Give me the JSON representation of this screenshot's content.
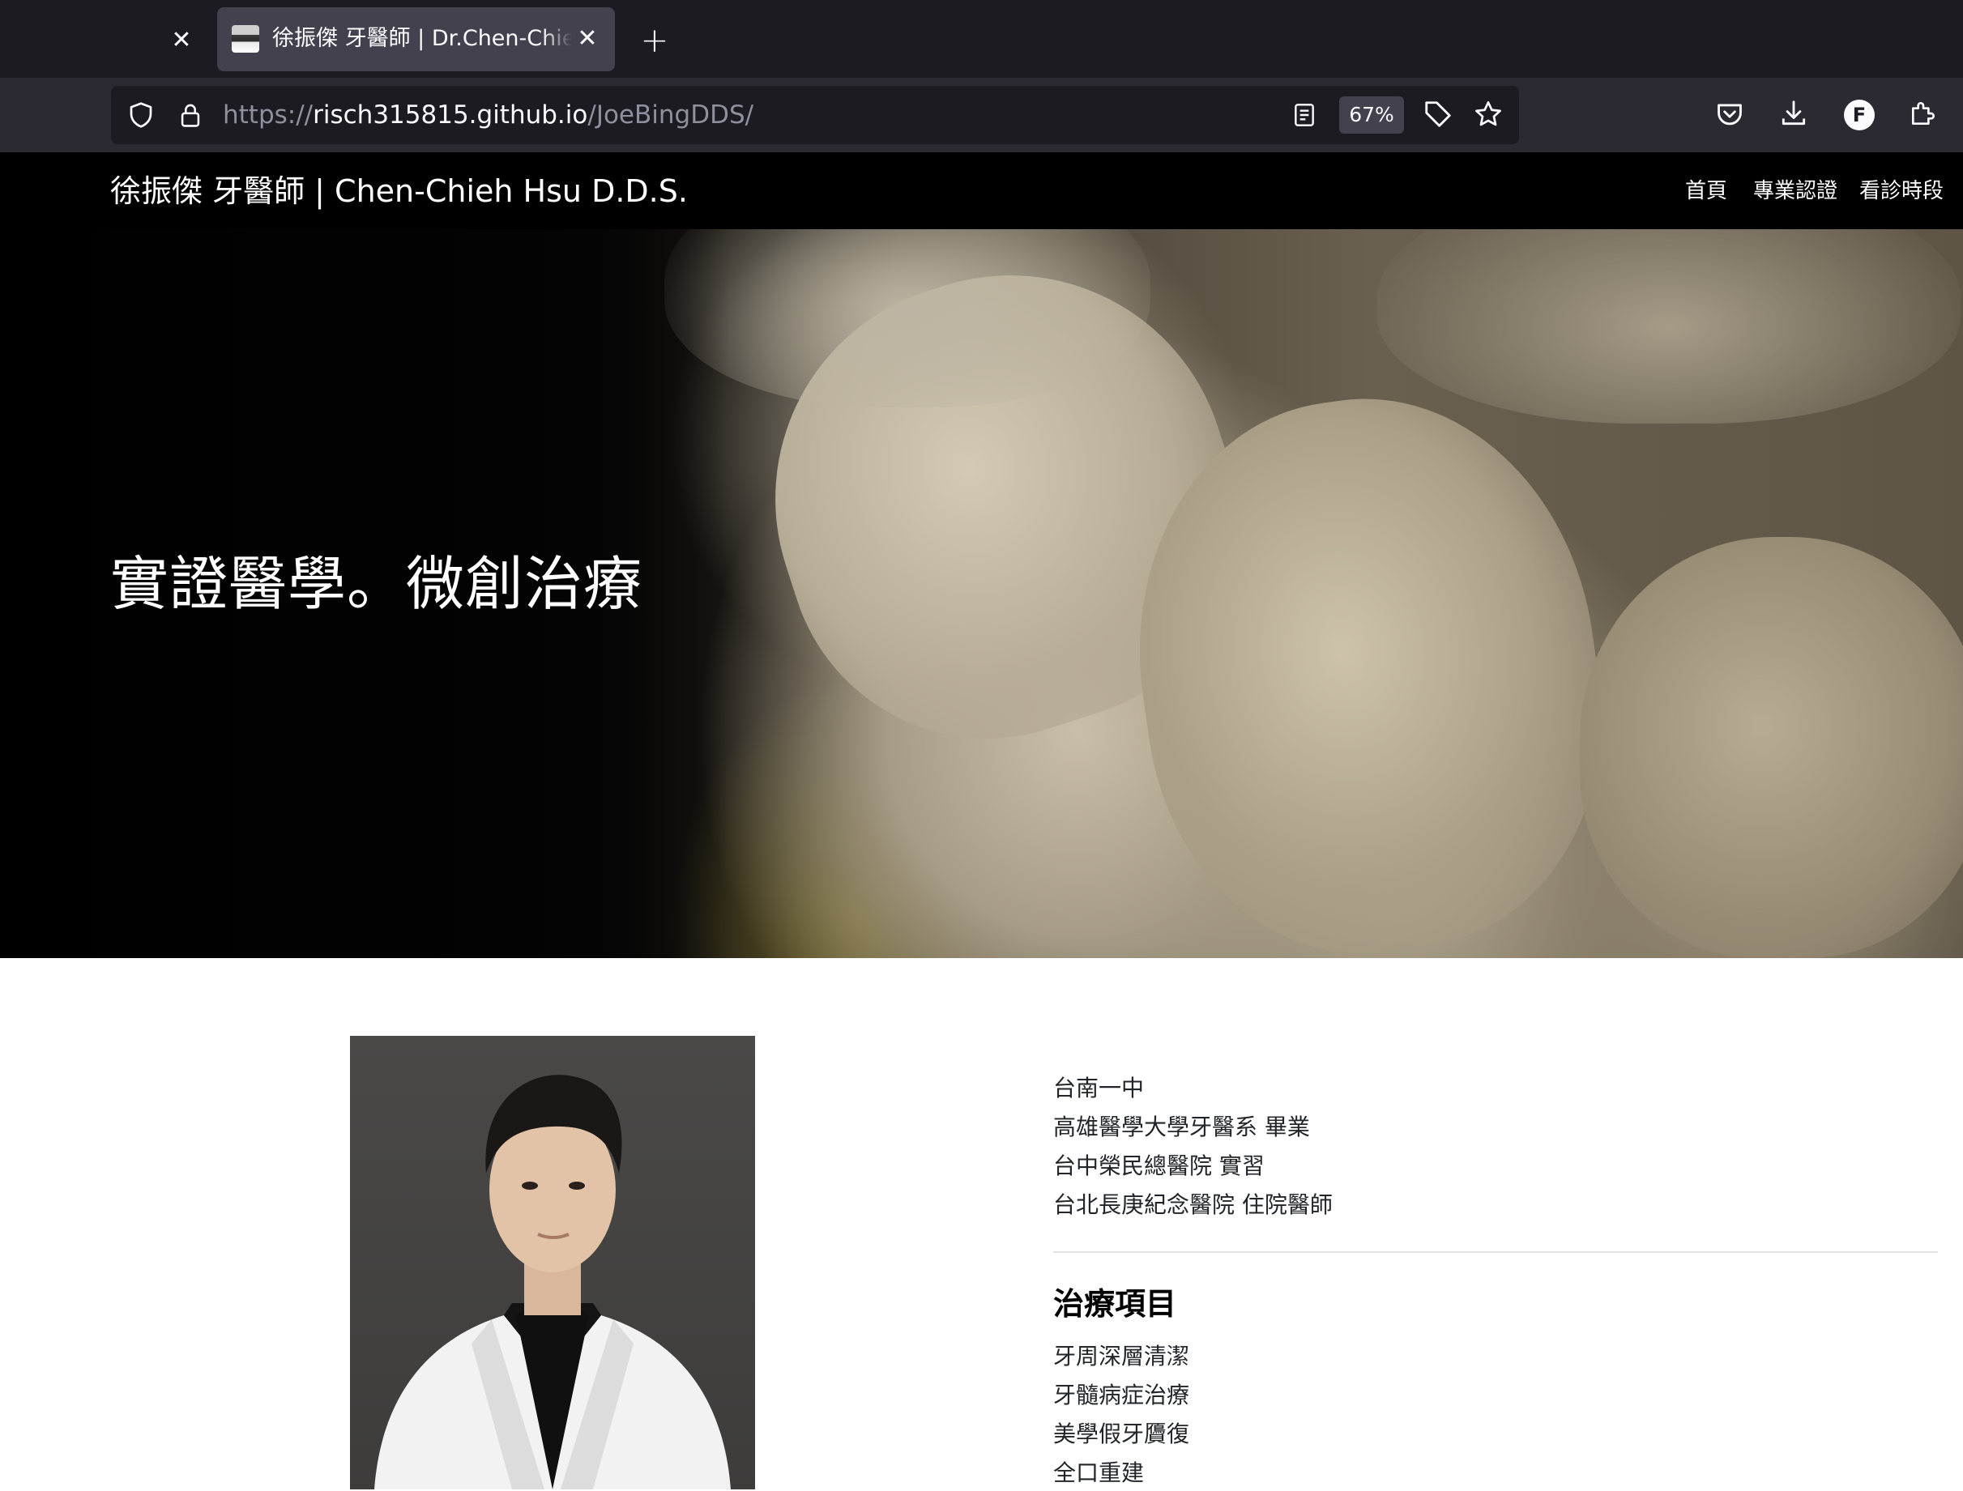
{
  "browser": {
    "tab": {
      "title": "徐振傑 牙醫師 | Dr.Chen-Chieh Hsu"
    },
    "url": {
      "scheme": "https://",
      "host": "risch315815.github.io",
      "path": "/JoeBingDDS/"
    },
    "zoom": "67%",
    "profile_initial": "F"
  },
  "site": {
    "brand": "徐振傑 牙醫師 | Chen-Chieh Hsu D.D.S.",
    "nav": [
      "首頁",
      "專業認證",
      "看診時段"
    ]
  },
  "hero": {
    "title": "實證醫學。微創治療"
  },
  "bio": {
    "education": [
      "台南一中",
      "高雄醫學大學牙醫系 畢業",
      "台中榮民總醫院 實習",
      "台北長庚紀念醫院 住院醫師"
    ]
  },
  "services": {
    "heading": "治療項目",
    "items": [
      "牙周深層清潔",
      "牙髓病症治療",
      "美學假牙贗復",
      "全口重建"
    ]
  }
}
